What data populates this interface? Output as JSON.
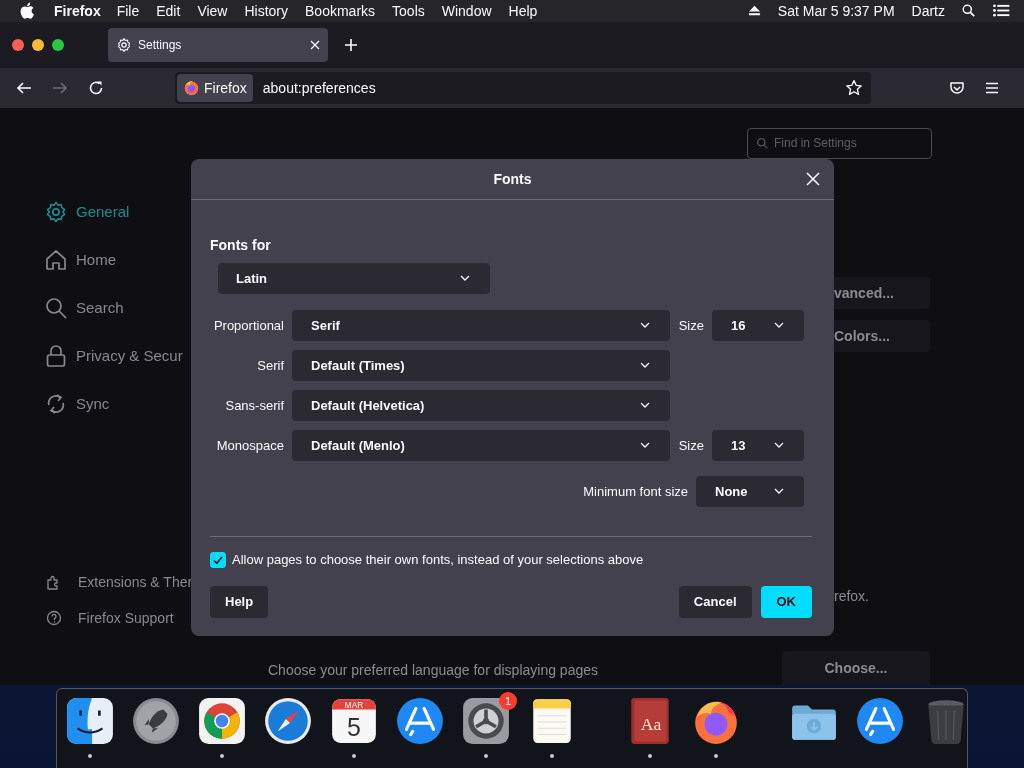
{
  "menu_bar": {
    "app": "Firefox",
    "items": [
      "File",
      "Edit",
      "View",
      "History",
      "Bookmarks",
      "Tools",
      "Window",
      "Help"
    ],
    "clock": "Sat Mar 5  9:37 PM",
    "user": "Dartz"
  },
  "tabs": [
    {
      "label": "Settings",
      "selected": true
    }
  ],
  "nav_buttons": [
    {
      "kind": "back",
      "disabled": false
    },
    {
      "kind": "forward",
      "disabled": true
    },
    {
      "kind": "reload",
      "disabled": false
    }
  ],
  "address_bar": {
    "identity": "Firefox",
    "url": "about:preferences"
  },
  "search": {
    "placeholder": "Find in Settings"
  },
  "sidebar": {
    "items": [
      {
        "kind": "general",
        "label": "General",
        "selected": true
      },
      {
        "kind": "home",
        "label": "Home",
        "selected": false
      },
      {
        "kind": "search",
        "label": "Search",
        "selected": false
      },
      {
        "kind": "privacy",
        "label": "Privacy & Secur",
        "selected": false
      },
      {
        "kind": "sync",
        "label": "Sync",
        "selected": false
      }
    ],
    "footer": [
      {
        "kind": "extensions",
        "label": "Extensions & Ther"
      },
      {
        "kind": "support",
        "label": "Firefox Support"
      }
    ]
  },
  "page": {
    "buttons": [
      "vanced...",
      "Colors..."
    ],
    "note": "refox.",
    "language_text": "Choose your preferred language for displaying pages",
    "language_button": "Choose..."
  },
  "dialog": {
    "title": "Fonts",
    "fonts_for": "Fonts for",
    "language": "Latin",
    "rows": [
      {
        "label": "Proportional",
        "value": "Serif",
        "size_label": "Size",
        "size": "16"
      },
      {
        "label": "Serif",
        "value": "Default (Times)"
      },
      {
        "label": "Sans-serif",
        "value": "Default (Helvetica)"
      },
      {
        "label": "Monospace",
        "value": "Default (Menlo)",
        "size_label": "Size",
        "size": "13"
      }
    ],
    "min_size": {
      "label": "Minimum font size",
      "value": "None"
    },
    "allow": {
      "label": "Allow pages to choose their own fonts, instead of your selections above",
      "checked": true
    },
    "help": "Help",
    "cancel": "Cancel",
    "ok": "OK"
  },
  "dock": [
    {
      "kind": "finder",
      "running": true
    },
    {
      "kind": "launchpad",
      "running": false
    },
    {
      "kind": "chrome",
      "running": true
    },
    {
      "kind": "safari",
      "running": false
    },
    {
      "kind": "calendar",
      "running": true,
      "month": "MAR",
      "day": "5"
    },
    {
      "kind": "appstore",
      "running": false
    },
    {
      "kind": "preferences",
      "running": true,
      "badge": "1"
    },
    {
      "kind": "notes",
      "running": true
    },
    {
      "kind": "separator"
    },
    {
      "kind": "dictionary",
      "running": true,
      "text": "Aa"
    },
    {
      "kind": "firefox",
      "running": true
    },
    {
      "kind": "separator"
    },
    {
      "kind": "downloads",
      "running": false
    },
    {
      "kind": "appstore",
      "running": false
    },
    {
      "kind": "trash",
      "running": false
    }
  ]
}
